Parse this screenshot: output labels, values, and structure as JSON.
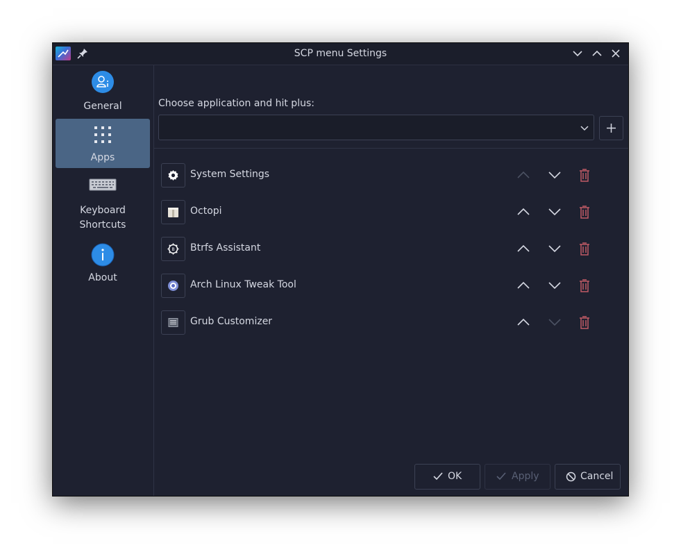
{
  "window": {
    "title": "SCP menu Settings"
  },
  "sidebar": {
    "items": [
      {
        "label": "General",
        "icon": "user-info-icon"
      },
      {
        "label": "Apps",
        "icon": "apps-grid-icon",
        "active": true
      },
      {
        "label": "Keyboard\nShortcuts",
        "icon": "keyboard-icon"
      },
      {
        "label": "About",
        "icon": "info-icon"
      }
    ]
  },
  "main": {
    "choose_label": "Choose application and hit plus:",
    "combo_value": "",
    "apps": [
      {
        "name": "System Settings",
        "icon": "gear-icon",
        "up_enabled": false,
        "down_enabled": true
      },
      {
        "name": "Octopi",
        "icon": "package-icon",
        "up_enabled": true,
        "down_enabled": true
      },
      {
        "name": "Btrfs Assistant",
        "icon": "btrfs-gear-icon",
        "up_enabled": true,
        "down_enabled": true
      },
      {
        "name": "Arch Linux Tweak Tool",
        "icon": "tweak-ring-icon",
        "up_enabled": true,
        "down_enabled": true
      },
      {
        "name": "Grub Customizer",
        "icon": "grub-window-icon",
        "up_enabled": true,
        "down_enabled": false
      }
    ]
  },
  "footer": {
    "ok_label": "OK",
    "apply_label": "Apply",
    "cancel_label": "Cancel"
  },
  "colors": {
    "background": "#1e2130",
    "active_item": "#4a6585",
    "text": "#d5d8e2",
    "delete_icon": "#c05a66",
    "accent_blue": "#2d8ce6"
  }
}
